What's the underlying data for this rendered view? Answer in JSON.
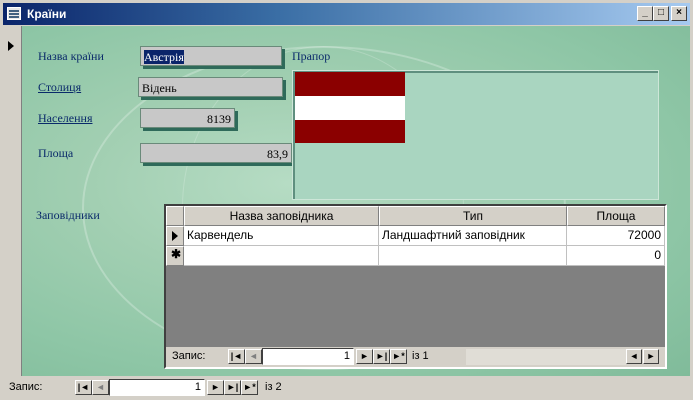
{
  "window": {
    "title": "Країни",
    "buttons": {
      "minimize": "_",
      "maximize": "□",
      "close": "×"
    }
  },
  "form": {
    "country_label": "Назва країни",
    "country_value": "Австрія",
    "capital_label": "Столиця",
    "capital_value": "Відень",
    "population_label": "Населення",
    "population_value": "8139",
    "area_label": "Площа",
    "area_value": "83,9",
    "flag_label": "Прапор",
    "flag_colors": [
      "#8b0000",
      "#ffffff",
      "#8b0000"
    ],
    "reserves_label": "Заповідники"
  },
  "subform": {
    "columns": [
      "Назва заповідника",
      "Тип",
      "Площа"
    ],
    "rows": [
      {
        "name": "Карвендель",
        "type": "Ландшафтний заповідник",
        "area": "72000"
      },
      {
        "name": "",
        "type": "",
        "area": "0"
      }
    ],
    "nav": {
      "label": "Запис:",
      "current": "1",
      "of_text": "із 1"
    }
  },
  "main_nav": {
    "label": "Запис:",
    "current": "1",
    "of_text": "із 2"
  },
  "icons": {
    "first": "|◄",
    "prev": "◄",
    "next": "►",
    "last": "►|",
    "new": "►*",
    "scroll_left": "◄",
    "scroll_right": "►"
  }
}
